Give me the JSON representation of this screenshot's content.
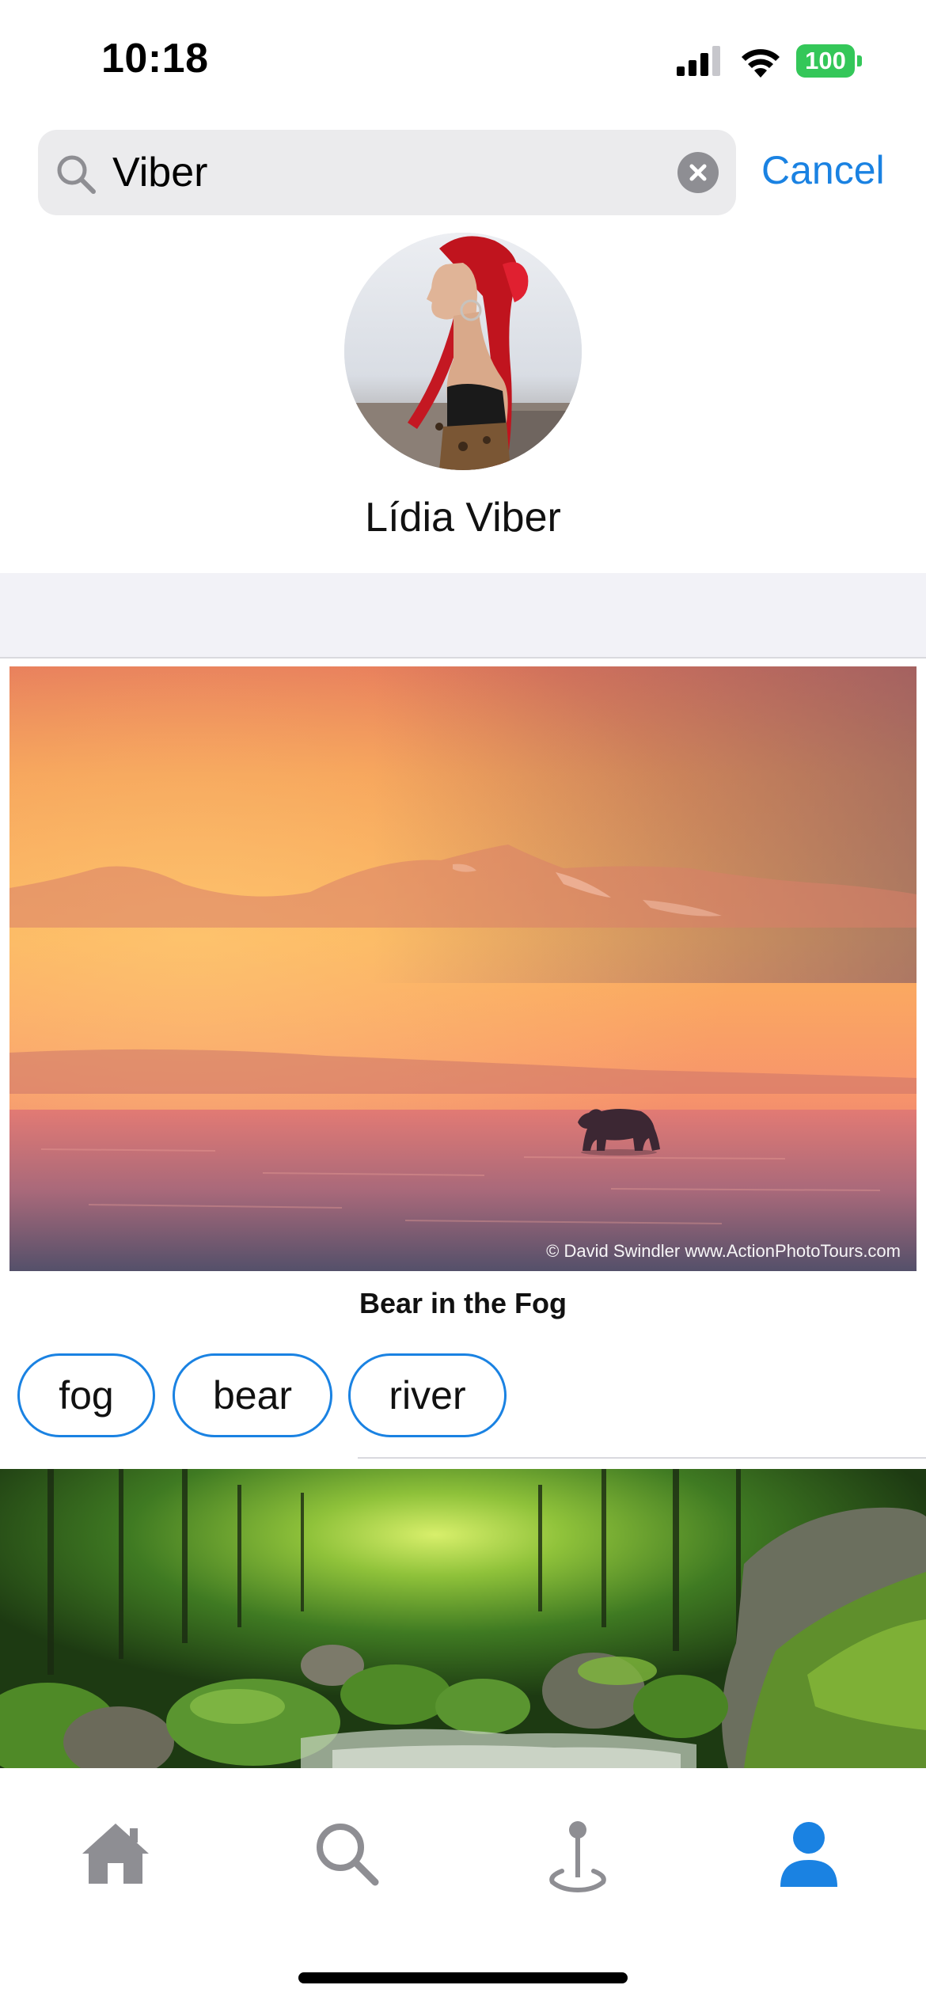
{
  "status_bar": {
    "time": "10:18",
    "battery_level": "100",
    "icons": [
      "signal-icon",
      "wifi-icon",
      "battery-icon"
    ]
  },
  "search": {
    "query": "Viber",
    "cancel_label": "Cancel",
    "icons": [
      "search-icon",
      "clear-icon"
    ]
  },
  "profile": {
    "name": "Lídia Viber"
  },
  "posts": [
    {
      "title": "Bear in the Fog",
      "credit": "© David Swindler  www.ActionPhotoTours.com",
      "tags": [
        "fog",
        "bear",
        "river"
      ]
    }
  ],
  "tab_bar": {
    "items": [
      "home-icon",
      "search-icon",
      "map-pin-icon",
      "profile-icon"
    ],
    "active": "profile-icon"
  },
  "colors": {
    "accent": "#1a82e2",
    "battery": "#34c759",
    "inactive_tab": "#8e8e93"
  }
}
